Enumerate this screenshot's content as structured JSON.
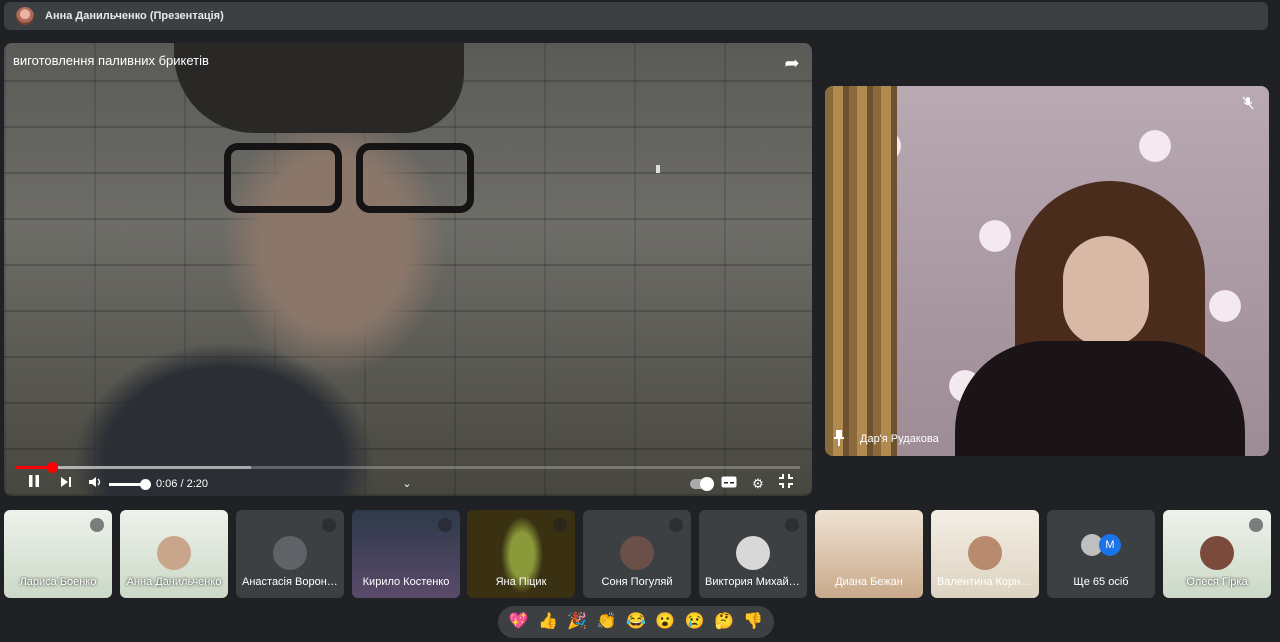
{
  "topbar": {
    "presenter_label": "Анна Данильченко (Презентація)"
  },
  "video": {
    "title": "виготовлення паливних брикетів",
    "time": "0:06 / 2:20",
    "progress_fraction": 0.046,
    "buffered_fraction": 0.3,
    "volume_fraction": 1.0,
    "icons": {
      "share": "share-icon",
      "play_pause": "pause-icon",
      "next": "skip-next-icon",
      "volume": "volume-icon",
      "chevron": "chevron-down-icon",
      "autoplay": "autoplay-toggle-icon",
      "captions": "captions-icon",
      "settings": "gear-icon",
      "exit_fullscreen": "exit-fullscreen-icon"
    }
  },
  "spotlight": {
    "name": "Дар'я Рудакова",
    "icons": {
      "pin": "pin-icon",
      "mic": "mic-off-icon"
    }
  },
  "participants": [
    {
      "name": "Лариса Боенко"
    },
    {
      "name": "Анна Данильченко"
    },
    {
      "name": "Анастасія Воронова"
    },
    {
      "name": "Кирило Костенко"
    },
    {
      "name": "Яна Піцик"
    },
    {
      "name": "Соня Погуляй"
    },
    {
      "name": "Виктория Михайлова"
    },
    {
      "name": "Диана Бежан"
    },
    {
      "name": "Валентина Корнієнко"
    },
    {
      "name": "Ще 65 осіб",
      "avatar_letter": "М"
    },
    {
      "name": "Олеся Гірка"
    }
  ],
  "reactions": [
    "💖",
    "👍",
    "🎉",
    "👏",
    "😂",
    "😮",
    "😢",
    "🤔",
    "👎"
  ],
  "colors": {
    "background": "#202124",
    "tile": "#3c4043",
    "progress_played": "#ff0000",
    "accent_avatar": "#1a73e8"
  }
}
